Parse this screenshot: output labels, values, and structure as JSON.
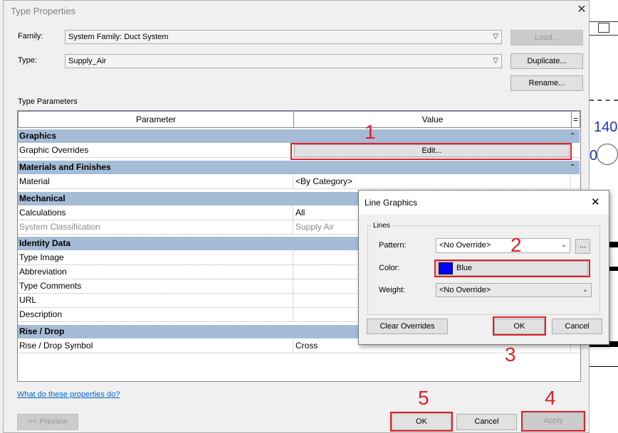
{
  "window": {
    "title": "Type Properties"
  },
  "family": {
    "label": "Family:",
    "value": "System Family: Duct System"
  },
  "type": {
    "label": "Type:",
    "value": "Supply_Air"
  },
  "buttons": {
    "load": "Load...",
    "duplicate": "Duplicate...",
    "rename": "Rename...",
    "preview": "<< Preview",
    "ok": "OK",
    "cancel": "Cancel",
    "apply": "Apply"
  },
  "type_parameters_label": "Type Parameters",
  "table": {
    "col_parameter": "Parameter",
    "col_value": "Value",
    "col_extra": "=",
    "groups": {
      "graphics": "Graphics",
      "materials": "Materials and Finishes",
      "mechanical": "Mechanical",
      "identity": "Identity Data",
      "rise": "Rise / Drop"
    },
    "rows": {
      "graphic_overrides": {
        "param": "Graphic Overrides",
        "value": "Edit..."
      },
      "material": {
        "param": "Material",
        "value": "<By Category>"
      },
      "calculations": {
        "param": "Calculations",
        "value": "All"
      },
      "system_classification": {
        "param": "System Classification",
        "value": "Supply Air"
      },
      "type_image": {
        "param": "Type Image",
        "value": ""
      },
      "abbreviation": {
        "param": "Abbreviation",
        "value": ""
      },
      "type_comments": {
        "param": "Type Comments",
        "value": ""
      },
      "url": {
        "param": "URL",
        "value": ""
      },
      "description": {
        "param": "Description",
        "value": ""
      },
      "rise_drop_symbol": {
        "param": "Rise / Drop Symbol",
        "value": "Cross"
      }
    }
  },
  "help_link": "What do these properties do?",
  "line_graphics": {
    "title": "Line Graphics",
    "group_label": "Lines",
    "pattern_label": "Pattern:",
    "pattern_value": "<No Override>",
    "pattern_more": "...",
    "color_label": "Color:",
    "color_value": "Blue",
    "color_hex": "#0000ff",
    "weight_label": "Weight:",
    "weight_value": "<No Override>",
    "clear_overrides": "Clear Overrides",
    "ok": "OK",
    "cancel": "Cancel"
  },
  "annotations": [
    "1",
    "2",
    "3",
    "4",
    "5"
  ],
  "background_app": {
    "labels": [
      "140",
      "0"
    ]
  },
  "accent_colors": {
    "annotation_red": "#e0202a",
    "group_header": "#a5bcd6"
  }
}
